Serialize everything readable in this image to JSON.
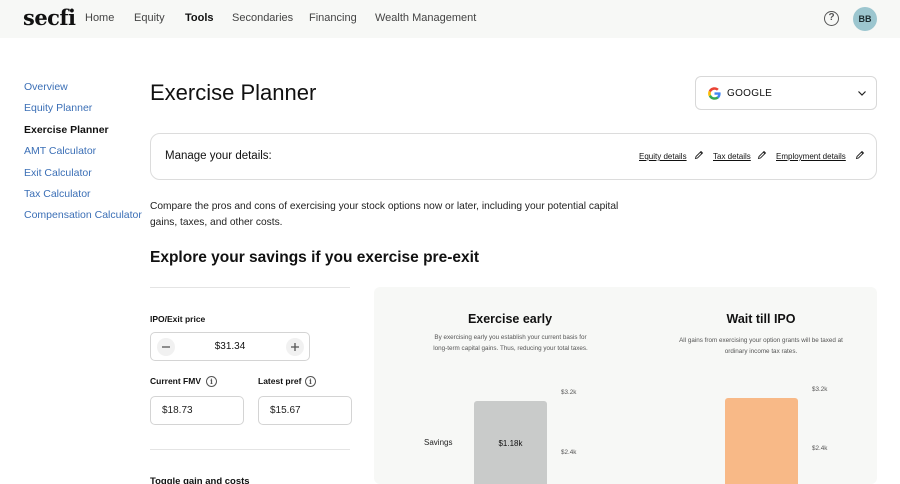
{
  "app": {
    "logo": "secfi"
  },
  "nav": [
    {
      "label": "Home",
      "active": false
    },
    {
      "label": "Equity",
      "active": false
    },
    {
      "label": "Tools",
      "active": true
    },
    {
      "label": "Secondaries",
      "active": false
    },
    {
      "label": "Financing",
      "active": false
    },
    {
      "label": "Wealth Management",
      "active": false
    }
  ],
  "user": {
    "initials": "BB",
    "help_icon": "?"
  },
  "sidebar": [
    {
      "label": "Overview",
      "active": false
    },
    {
      "label": "Equity Planner",
      "active": false
    },
    {
      "label": "Exercise Planner",
      "active": true
    },
    {
      "label": "AMT Calculator",
      "active": false
    },
    {
      "label": "Exit Calculator",
      "active": false
    },
    {
      "label": "Tax Calculator",
      "active": false
    },
    {
      "label": "Compensation Calculator",
      "active": false
    }
  ],
  "page": {
    "title": "Exercise Planner",
    "company": "GOOGLE",
    "details": {
      "title": "Manage your details:",
      "links": [
        "Equity details",
        "Tax details",
        "Employment details"
      ]
    },
    "description": "Compare the pros and cons of exercising your stock options now or later, including your potential capital gains, taxes, and other costs.",
    "section_title": "Explore your savings if you exercise pre-exit"
  },
  "inputs": {
    "ipo_label": "IPO/Exit price",
    "ipo_value": "$31.34",
    "fmv_label": "Current FMV",
    "fmv_value": "$18.73",
    "pref_label": "Latest pref",
    "pref_value": "$15.67",
    "toggle_label": "Toggle gain and costs"
  },
  "comparison": {
    "row_label": "Savings",
    "early": {
      "title": "Exercise early",
      "description": "By exercising early you establish your current basis for long-term capital gains. Thus, reducing your total taxes.",
      "axis": [
        "$3.2k",
        "$2.4k"
      ],
      "bar_label": "$1.18k",
      "bar_color": "#c9cbca"
    },
    "ipo": {
      "title": "Wait till IPO",
      "description": "All gains from exercising your option grants will be taxed at ordinary income tax rates.",
      "axis": [
        "$3.2k",
        "$2.4k"
      ],
      "bar_color": "#f8b987"
    }
  },
  "colors": {
    "link": "#3b6fb6",
    "nav_bg": "#f7f8f6",
    "avatar_bg": "#9cc6cf"
  }
}
